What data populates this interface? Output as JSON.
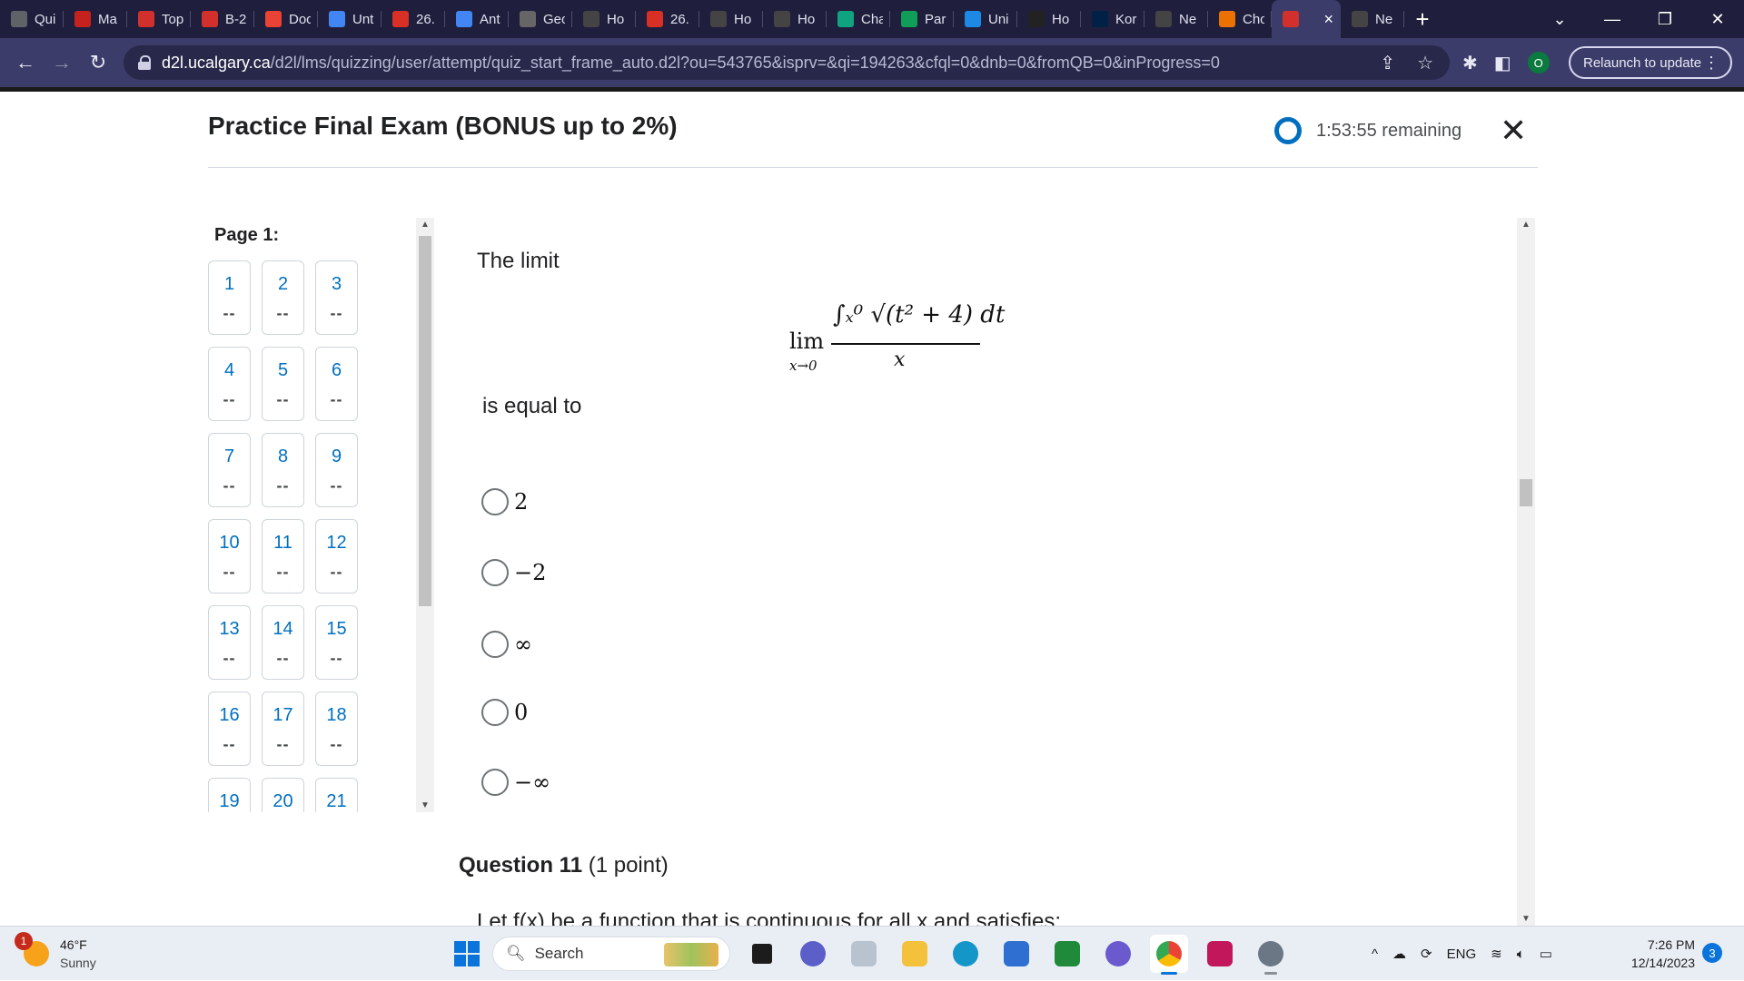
{
  "browser": {
    "tabs": [
      {
        "label": "Qui",
        "icon": "globe-icon",
        "color": "#5f6368"
      },
      {
        "label": "Ma",
        "icon": "mail-icon",
        "color": "#c5221f"
      },
      {
        "label": "Top",
        "icon": "crest-icon",
        "color": "#d2302d"
      },
      {
        "label": "B-2",
        "icon": "crest-icon",
        "color": "#d2302d"
      },
      {
        "label": "Doc",
        "icon": "gmail-icon",
        "color": "#ea4335"
      },
      {
        "label": "Unt",
        "icon": "docs-icon",
        "color": "#4285f4"
      },
      {
        "label": "26.",
        "icon": "pb-icon",
        "color": "#d93025"
      },
      {
        "label": "Ant",
        "icon": "docs-icon",
        "color": "#4285f4"
      },
      {
        "label": "Geo",
        "icon": "geogebra-icon",
        "color": "#666666"
      },
      {
        "label": "Ho",
        "icon": "openai-icon",
        "color": "#444444"
      },
      {
        "label": "26.",
        "icon": "pb-icon",
        "color": "#d93025"
      },
      {
        "label": "Ho",
        "icon": "openai-icon",
        "color": "#444444"
      },
      {
        "label": "Ho",
        "icon": "openai-icon",
        "color": "#444444"
      },
      {
        "label": "Cha",
        "icon": "chatgpt-icon",
        "color": "#10a37f"
      },
      {
        "label": "Par",
        "icon": "calc-icon",
        "color": "#0f9d58"
      },
      {
        "label": "Uni",
        "icon": "cloud-icon",
        "color": "#1e88e5"
      },
      {
        "label": "Ho",
        "icon": "obo-icon",
        "color": "#222222"
      },
      {
        "label": "Kor",
        "icon": "ubc-icon",
        "color": "#002145"
      },
      {
        "label": "Ne",
        "icon": "openai-icon",
        "color": "#444444"
      },
      {
        "label": "Cho",
        "icon": "chegg-icon",
        "color": "#eb7100"
      },
      {
        "label": "",
        "icon": "crest-icon",
        "color": "#d2302d",
        "active": true
      },
      {
        "label": "Ne",
        "icon": "openai-icon",
        "color": "#444444"
      }
    ],
    "new_tab": "+",
    "window_controls": {
      "minimize": "—",
      "restore": "❐",
      "close": "✕"
    },
    "url_host": "d2l.ucalgary.ca",
    "url_path": "/d2l/lms/quizzing/user/attempt/quiz_start_frame_auto.d2l?ou=543765&isprv=&qi=194263&cfql=0&dnb=0&fromQB=0&inProgress=0",
    "profile_initial": "O",
    "relaunch_label": "Relaunch to update"
  },
  "quiz": {
    "title": "Practice Final Exam (BONUS up to 2%)",
    "timer": "1:53:55 remaining",
    "page_label": "Page 1:",
    "question_nav": [
      {
        "num": "1",
        "status": "--"
      },
      {
        "num": "2",
        "status": "--"
      },
      {
        "num": "3",
        "status": "--"
      },
      {
        "num": "4",
        "status": "--"
      },
      {
        "num": "5",
        "status": "--"
      },
      {
        "num": "6",
        "status": "--"
      },
      {
        "num": "7",
        "status": "--"
      },
      {
        "num": "8",
        "status": "--"
      },
      {
        "num": "9",
        "status": "--"
      },
      {
        "num": "10",
        "status": "--"
      },
      {
        "num": "11",
        "status": "--"
      },
      {
        "num": "12",
        "status": "--"
      },
      {
        "num": "13",
        "status": "--"
      },
      {
        "num": "14",
        "status": "--"
      },
      {
        "num": "15",
        "status": "--"
      },
      {
        "num": "16",
        "status": "--"
      },
      {
        "num": "17",
        "status": "--"
      },
      {
        "num": "18",
        "status": "--"
      },
      {
        "num": "19",
        "status": ""
      },
      {
        "num": "20",
        "status": ""
      },
      {
        "num": "21",
        "status": ""
      }
    ],
    "question": {
      "intro": "The limit",
      "formula": {
        "lim": "lim",
        "lim_sub": "x→0",
        "numerator": "∫ₓ⁰ √(t² + 4) dt",
        "denominator": "x"
      },
      "equal_to": "is equal to",
      "options": [
        "2",
        "−2",
        "∞",
        "0",
        "−∞"
      ]
    },
    "next_question": {
      "title": "Question 11",
      "points": "(1 point)",
      "text": "Let f(x) be a function that is continuous for all x and satisfies:"
    }
  },
  "taskbar": {
    "weather_badge": "1",
    "temperature": "46°F",
    "condition": "Sunny",
    "search_placeholder": "Search",
    "tray_language": "ENG",
    "time": "7:26 PM",
    "date": "12/14/2023",
    "notifications": "3"
  }
}
